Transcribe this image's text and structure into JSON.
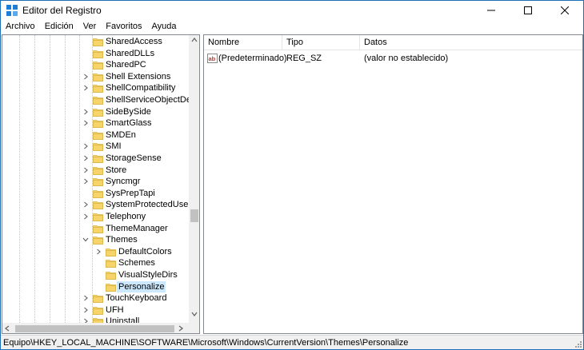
{
  "window": {
    "title": "Editor del Registro"
  },
  "menu": {
    "items": [
      "Archivo",
      "Edición",
      "Ver",
      "Favoritos",
      "Ayuda"
    ]
  },
  "tree": {
    "items": [
      {
        "label": "SharedAccess",
        "expandable": false,
        "level": 1
      },
      {
        "label": "SharedDLLs",
        "expandable": false,
        "level": 1
      },
      {
        "label": "SharedPC",
        "expandable": false,
        "level": 1
      },
      {
        "label": "Shell Extensions",
        "expandable": true,
        "level": 1
      },
      {
        "label": "ShellCompatibility",
        "expandable": true,
        "level": 1
      },
      {
        "label": "ShellServiceObjectDelayl",
        "expandable": false,
        "level": 1
      },
      {
        "label": "SideBySide",
        "expandable": true,
        "level": 1
      },
      {
        "label": "SmartGlass",
        "expandable": true,
        "level": 1
      },
      {
        "label": "SMDEn",
        "expandable": false,
        "level": 1
      },
      {
        "label": "SMI",
        "expandable": true,
        "level": 1
      },
      {
        "label": "StorageSense",
        "expandable": true,
        "level": 1
      },
      {
        "label": "Store",
        "expandable": true,
        "level": 1
      },
      {
        "label": "Syncmgr",
        "expandable": true,
        "level": 1
      },
      {
        "label": "SysPrepTapi",
        "expandable": false,
        "level": 1
      },
      {
        "label": "SystemProtectedUserDat",
        "expandable": true,
        "level": 1
      },
      {
        "label": "Telephony",
        "expandable": true,
        "level": 1
      },
      {
        "label": "ThemeManager",
        "expandable": false,
        "level": 1
      },
      {
        "label": "Themes",
        "expandable": true,
        "expanded": true,
        "level": 1
      },
      {
        "label": "DefaultColors",
        "expandable": true,
        "level": 2
      },
      {
        "label": "Schemes",
        "expandable": false,
        "level": 2
      },
      {
        "label": "VisualStyleDirs",
        "expandable": false,
        "level": 2
      },
      {
        "label": "Personalize",
        "expandable": false,
        "level": 2,
        "selected": true
      },
      {
        "label": "TouchKeyboard",
        "expandable": true,
        "level": 1
      },
      {
        "label": "UFH",
        "expandable": true,
        "level": 1
      },
      {
        "label": "Uninstall",
        "expandable": true,
        "level": 1
      }
    ]
  },
  "list": {
    "columns": {
      "name": "Nombre",
      "type": "Tipo",
      "data": "Datos"
    },
    "rows": [
      {
        "name": "(Predeterminado)",
        "type": "REG_SZ",
        "data": "(valor no establecido)",
        "icon": "string-value-icon"
      }
    ]
  },
  "status": {
    "path": "Equipo\\HKEY_LOCAL_MACHINE\\SOFTWARE\\Microsoft\\Windows\\CurrentVersion\\Themes\\Personalize"
  },
  "colors": {
    "selection": "#cce8ff",
    "folder": "#f6d469",
    "border": "#828790"
  }
}
